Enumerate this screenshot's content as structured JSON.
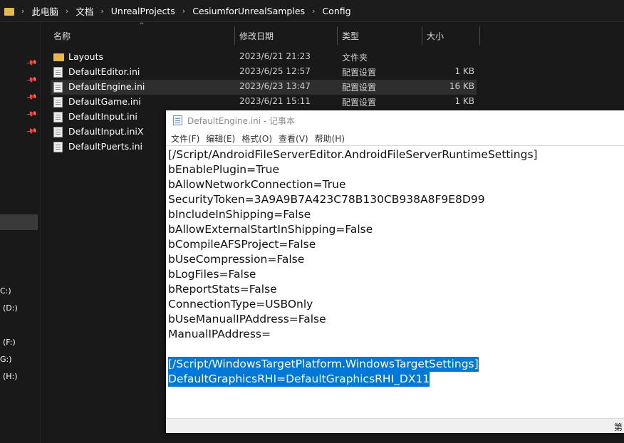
{
  "address_bar": {
    "crumbs": [
      "此电脑",
      "文档",
      "UnrealProjects",
      "CesiumforUnrealSamples",
      "Config"
    ],
    "separator": "›"
  },
  "nav_pane": {
    "drives": [
      "C:)",
      "(D:)",
      "(F:)",
      "G:)",
      "(H:)"
    ]
  },
  "columns": {
    "name": "名称",
    "date": "修改日期",
    "type": "类型",
    "size": "大小"
  },
  "files": [
    {
      "name": "Layouts",
      "date": "2023/6/21 21:23",
      "type": "文件夹",
      "size": "",
      "icon": "folder-icon"
    },
    {
      "name": "DefaultEditor.ini",
      "date": "2023/6/25 12:57",
      "type": "配置设置",
      "size": "1 KB",
      "icon": "ini-file-icon"
    },
    {
      "name": "DefaultEngine.ini",
      "date": "2023/6/23 13:47",
      "type": "配置设置",
      "size": "16 KB",
      "icon": "ini-file-icon"
    },
    {
      "name": "DefaultGame.ini",
      "date": "2023/6/21 15:11",
      "type": "配置设置",
      "size": "1 KB",
      "icon": "ini-file-icon"
    },
    {
      "name": "DefaultInput.ini",
      "date": "",
      "type": "",
      "size": "",
      "icon": "ini-file-icon"
    },
    {
      "name": "DefaultInput.iniX",
      "date": "",
      "type": "",
      "size": "",
      "icon": "file-icon"
    },
    {
      "name": "DefaultPuerts.ini",
      "date": "",
      "type": "",
      "size": "",
      "icon": "ini-file-icon"
    }
  ],
  "notepad": {
    "title": "DefaultEngine.ini - 记事本",
    "menu": [
      "文件(F)",
      "编辑(E)",
      "格式(O)",
      "查看(V)",
      "帮助(H)"
    ],
    "lines": [
      "[/Script/AndroidFileServerEditor.AndroidFileServerRuntimeSettings]",
      "bEnablePlugin=True",
      "bAllowNetworkConnection=True",
      "SecurityToken=3A9A9B7A423C78B130CB938A8F9E8D99",
      "bIncludeInShipping=False",
      "bAllowExternalStartInShipping=False",
      "bCompileAFSProject=False",
      "bUseCompression=False",
      "bLogFiles=False",
      "bReportStats=False",
      "ConnectionType=USBOnly",
      "bUseManualIPAddress=False",
      "ManualIPAddress=",
      "",
      "[/Script/WindowsTargetPlatform.WindowsTargetSettings]",
      "DefaultGraphicsRHI=DefaultGraphicsRHI_DX11"
    ],
    "selected_lines": [
      14,
      15
    ],
    "status_text": "第"
  },
  "colors": {
    "explorer_bg": "#191919",
    "folder": "#e8b84a",
    "selection": "#0078d7"
  }
}
